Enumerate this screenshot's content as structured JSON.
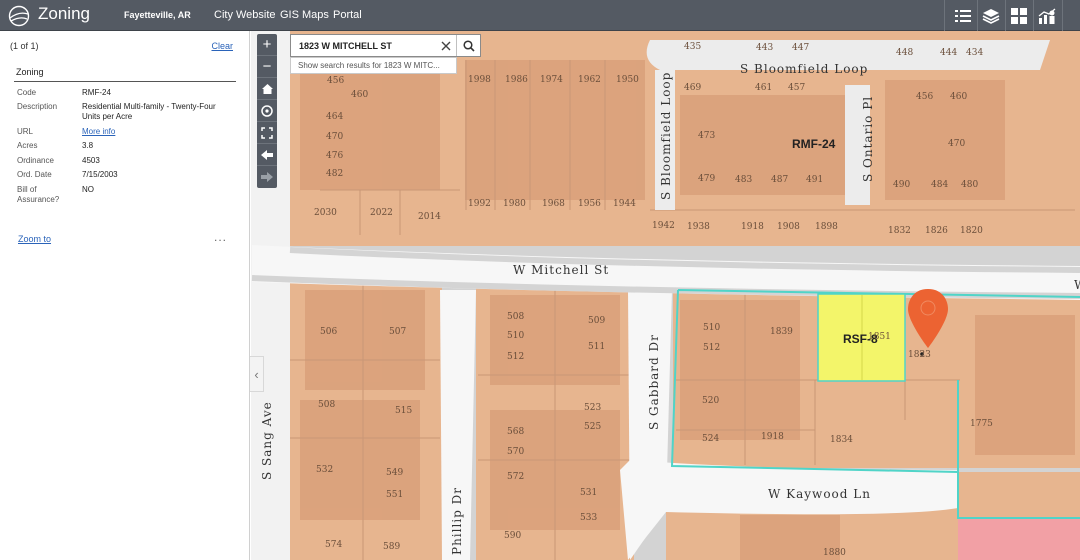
{
  "header": {
    "app_title": "Zoning",
    "city": "Fayetteville, AR",
    "links": [
      "City Website",
      "GIS Maps",
      "Portal"
    ]
  },
  "panel": {
    "count": "(1 of 1)",
    "clear_label": "Clear",
    "title": "Zoning",
    "attributes": [
      {
        "label": "Code",
        "value": "RMF-24"
      },
      {
        "label": "Description",
        "value": "Residential Multi-family - Twenty-Four Units per Acre"
      },
      {
        "label": "URL",
        "value": "More info"
      },
      {
        "label": "Acres",
        "value": "3.8"
      },
      {
        "label": "Ordinance",
        "value": "4503"
      },
      {
        "label": "Ord. Date",
        "value": "7/15/2003"
      },
      {
        "label": "Bill of Assurance?",
        "value": "NO"
      }
    ],
    "zoom_to": "Zoom to",
    "more": "..."
  },
  "search": {
    "value": "1823 W MITCHELL ST",
    "suggestion": "Show search results for 1823 W MITC..."
  },
  "map": {
    "streets": [
      "S Bloomfield Loop",
      "S Bloomfield Loop",
      "S Ontario Pl",
      "W Mitchell St",
      "S Gabbard Dr",
      "S Sang Ave",
      "Phillip Dr",
      "W Kaywood Ln",
      "W"
    ],
    "zones": [
      "RMF-24",
      "RSF-8"
    ],
    "addresses": [
      "435",
      "443",
      "447",
      "448",
      "444",
      "434",
      "456",
      "460",
      "1998",
      "1986",
      "1974",
      "1962",
      "1950",
      "469",
      "461",
      "457",
      "456",
      "460",
      "464",
      "470",
      "473",
      "470",
      "476",
      "482",
      "479",
      "483",
      "487",
      "491",
      "490",
      "484",
      "480",
      "2030",
      "2022",
      "2014",
      "1992",
      "1980",
      "1968",
      "1956",
      "1944",
      "1942",
      "1938",
      "1918",
      "1908",
      "1898",
      "1832",
      "1826",
      "1820",
      "506",
      "507",
      "508",
      "510",
      "512",
      "509",
      "511",
      "510",
      "512",
      "1839",
      "1851",
      "1823",
      "508",
      "515",
      "520",
      "523",
      "525",
      "568",
      "570",
      "524",
      "1918",
      "1834",
      "1775",
      "532",
      "549",
      "551",
      "572",
      "531",
      "533",
      "574",
      "589",
      "590",
      "1880"
    ],
    "colors": {
      "rmf24": "#e7b58f",
      "rsf8": "#f3f56a",
      "outline": "#50d4c8",
      "pin": "#ec6332",
      "pink": "#f2a0a5"
    }
  }
}
